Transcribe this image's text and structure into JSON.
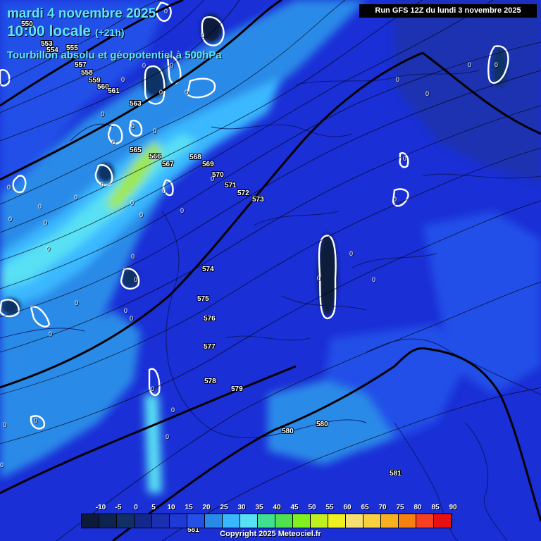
{
  "header": {
    "date": "mardi 4 novembre 2025",
    "time": "10:00 locale",
    "offset": "(+21h)",
    "parameter": "Tourbillon absolu et géopotentiel à 500hPa",
    "run": "Run GFS 12Z du lundi 3 novembre 2025"
  },
  "footer": {
    "copyright": "Copyright 2025 Meteociel.fr"
  },
  "colors": {
    "background": "#1a2fd6",
    "title": "#5ee8ff",
    "jet_core": "#9fe84a",
    "contour": "#000000"
  },
  "legend": {
    "ticks": [
      "-10",
      "-5",
      "0",
      "5",
      "10",
      "15",
      "20",
      "25",
      "30",
      "35",
      "40",
      "45",
      "50",
      "55",
      "60",
      "65",
      "70",
      "75",
      "80",
      "85",
      "90"
    ],
    "colors": [
      "#0e1a3a",
      "#0d2450",
      "#103066",
      "#14288c",
      "#1a30b0",
      "#1f3ad2",
      "#2450e8",
      "#2a8ae8",
      "#3ab8ff",
      "#58e0f4",
      "#40e090",
      "#50e050",
      "#80f020",
      "#c0f020",
      "#f0f020",
      "#f8e070",
      "#f8d040",
      "#f8b020",
      "#f88010",
      "#f84020",
      "#e81010"
    ]
  },
  "geopotential_labels": [
    {
      "v": "550"
    },
    {
      "v": "553"
    },
    {
      "v": "554"
    },
    {
      "v": "555"
    },
    {
      "v": "557"
    },
    {
      "v": "558"
    },
    {
      "v": "559"
    },
    {
      "v": "560"
    },
    {
      "v": "561"
    },
    {
      "v": "563"
    },
    {
      "v": "565"
    },
    {
      "v": "566"
    },
    {
      "v": "567"
    },
    {
      "v": "568"
    },
    {
      "v": "569"
    },
    {
      "v": "570"
    },
    {
      "v": "571"
    },
    {
      "v": "572"
    },
    {
      "v": "573"
    },
    {
      "v": "574"
    },
    {
      "v": "575"
    },
    {
      "v": "576"
    },
    {
      "v": "577"
    },
    {
      "v": "578"
    },
    {
      "v": "579"
    },
    {
      "v": "580"
    },
    {
      "v": "580"
    },
    {
      "v": "581"
    },
    {
      "v": "581"
    }
  ],
  "zero_label": "0"
}
